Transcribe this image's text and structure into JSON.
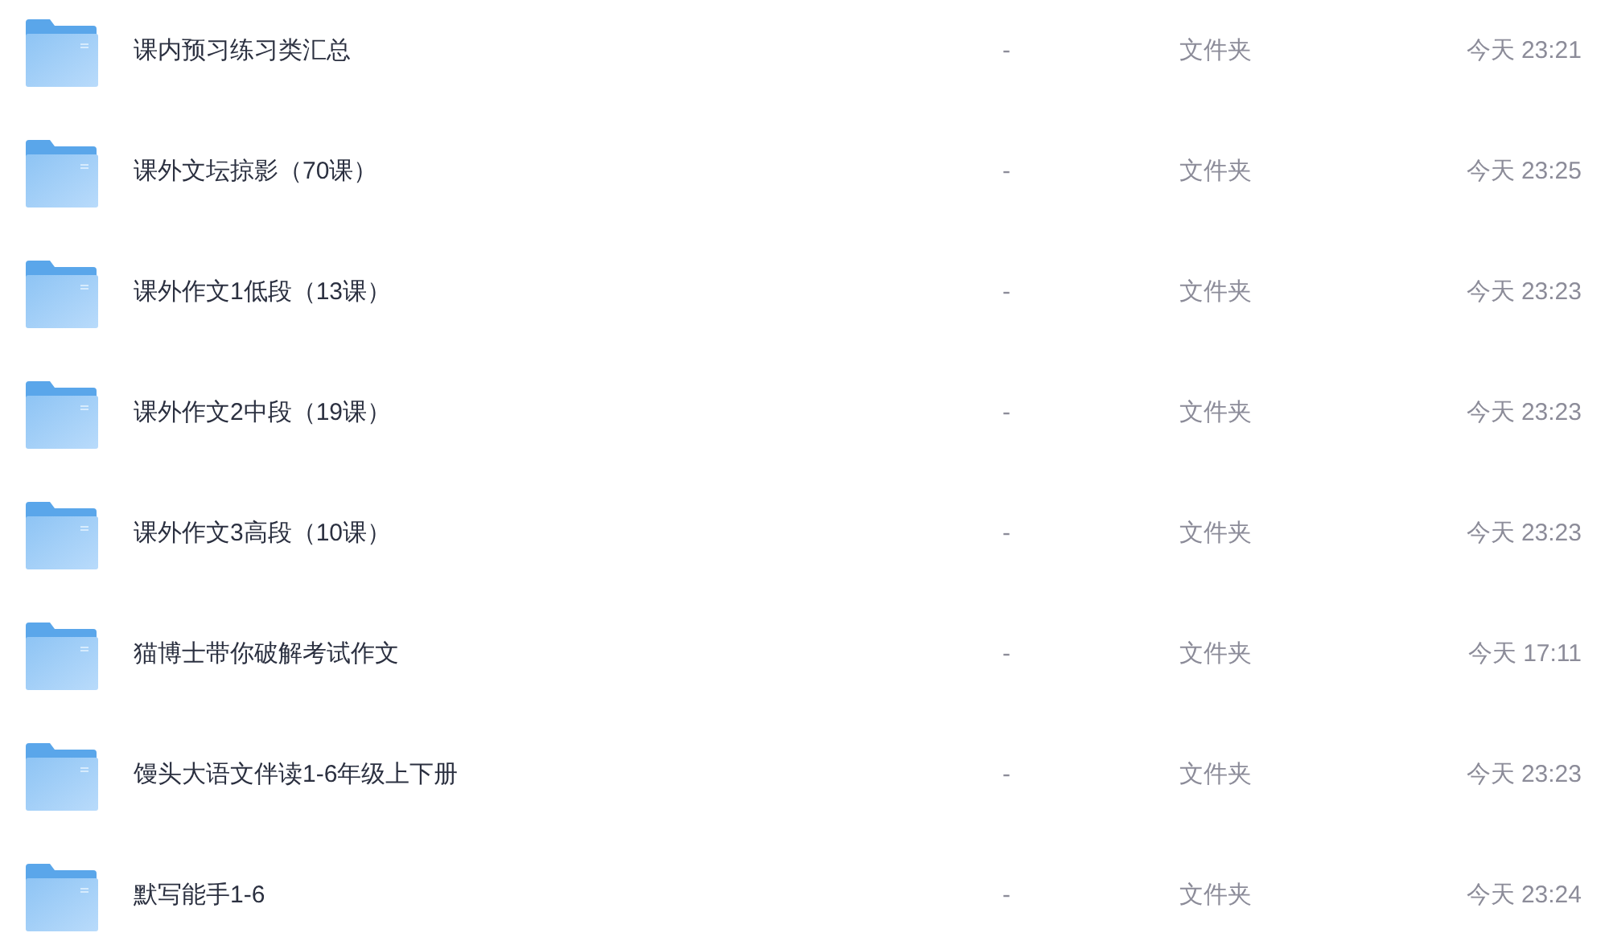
{
  "files": [
    {
      "name": "课内预习练习类汇总",
      "size": "-",
      "type": "文件夹",
      "modified": "今天 23:21"
    },
    {
      "name": "课外文坛掠影（70课）",
      "size": "-",
      "type": "文件夹",
      "modified": "今天 23:25"
    },
    {
      "name": "课外作文1低段（13课）",
      "size": "-",
      "type": "文件夹",
      "modified": "今天 23:23"
    },
    {
      "name": "课外作文2中段（19课）",
      "size": "-",
      "type": "文件夹",
      "modified": "今天 23:23"
    },
    {
      "name": "课外作文3高段（10课）",
      "size": "-",
      "type": "文件夹",
      "modified": "今天 23:23"
    },
    {
      "name": "猫博士带你破解考试作文",
      "size": "-",
      "type": "文件夹",
      "modified": "今天 17:11"
    },
    {
      "name": "馒头大语文伴读1-6年级上下册",
      "size": "-",
      "type": "文件夹",
      "modified": "今天 23:23"
    },
    {
      "name": "默写能手1-6",
      "size": "-",
      "type": "文件夹",
      "modified": "今天 23:24"
    }
  ]
}
